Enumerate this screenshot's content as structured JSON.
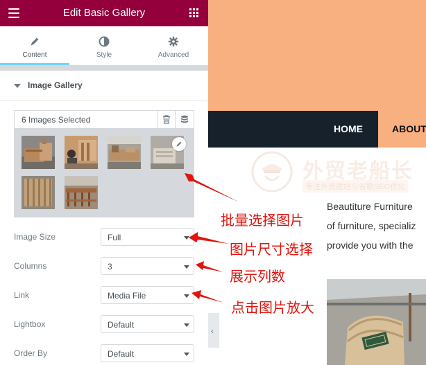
{
  "editor": {
    "header_title": "Edit Basic Gallery",
    "tabs": [
      {
        "label": "Content",
        "icon": "pencil-icon",
        "active": true
      },
      {
        "label": "Style",
        "icon": "half-circle-icon",
        "active": false
      },
      {
        "label": "Advanced",
        "icon": "gear-icon",
        "active": false
      }
    ],
    "section_title": "Image Gallery",
    "gallery": {
      "count_label": "6 Images Selected",
      "thumbnail_count": 6
    },
    "controls": [
      {
        "label": "Image Size",
        "value": "Full"
      },
      {
        "label": "Columns",
        "value": "3"
      },
      {
        "label": "Link",
        "value": "Media File"
      },
      {
        "label": "Lightbox",
        "value": "Default"
      },
      {
        "label": "Order By",
        "value": "Default"
      }
    ],
    "colors": {
      "header": "#93003c",
      "active_tab": "#71d7f7"
    }
  },
  "preview": {
    "nav": {
      "home": "HOME",
      "about": "ABOUT"
    },
    "watermark": {
      "title": "外贸老船长",
      "subtitle": "专注外贸建站与谷歌SEO优化"
    },
    "paragraph": [
      "Beautiture Furniture",
      "of furniture, specializ",
      "provide you with the"
    ],
    "colors": {
      "banner": "#f9b081",
      "nav": "#16212b"
    }
  },
  "annotations": [
    "批量选择图片",
    "图片尺寸选择",
    "展示列数",
    "点击图片放大"
  ]
}
